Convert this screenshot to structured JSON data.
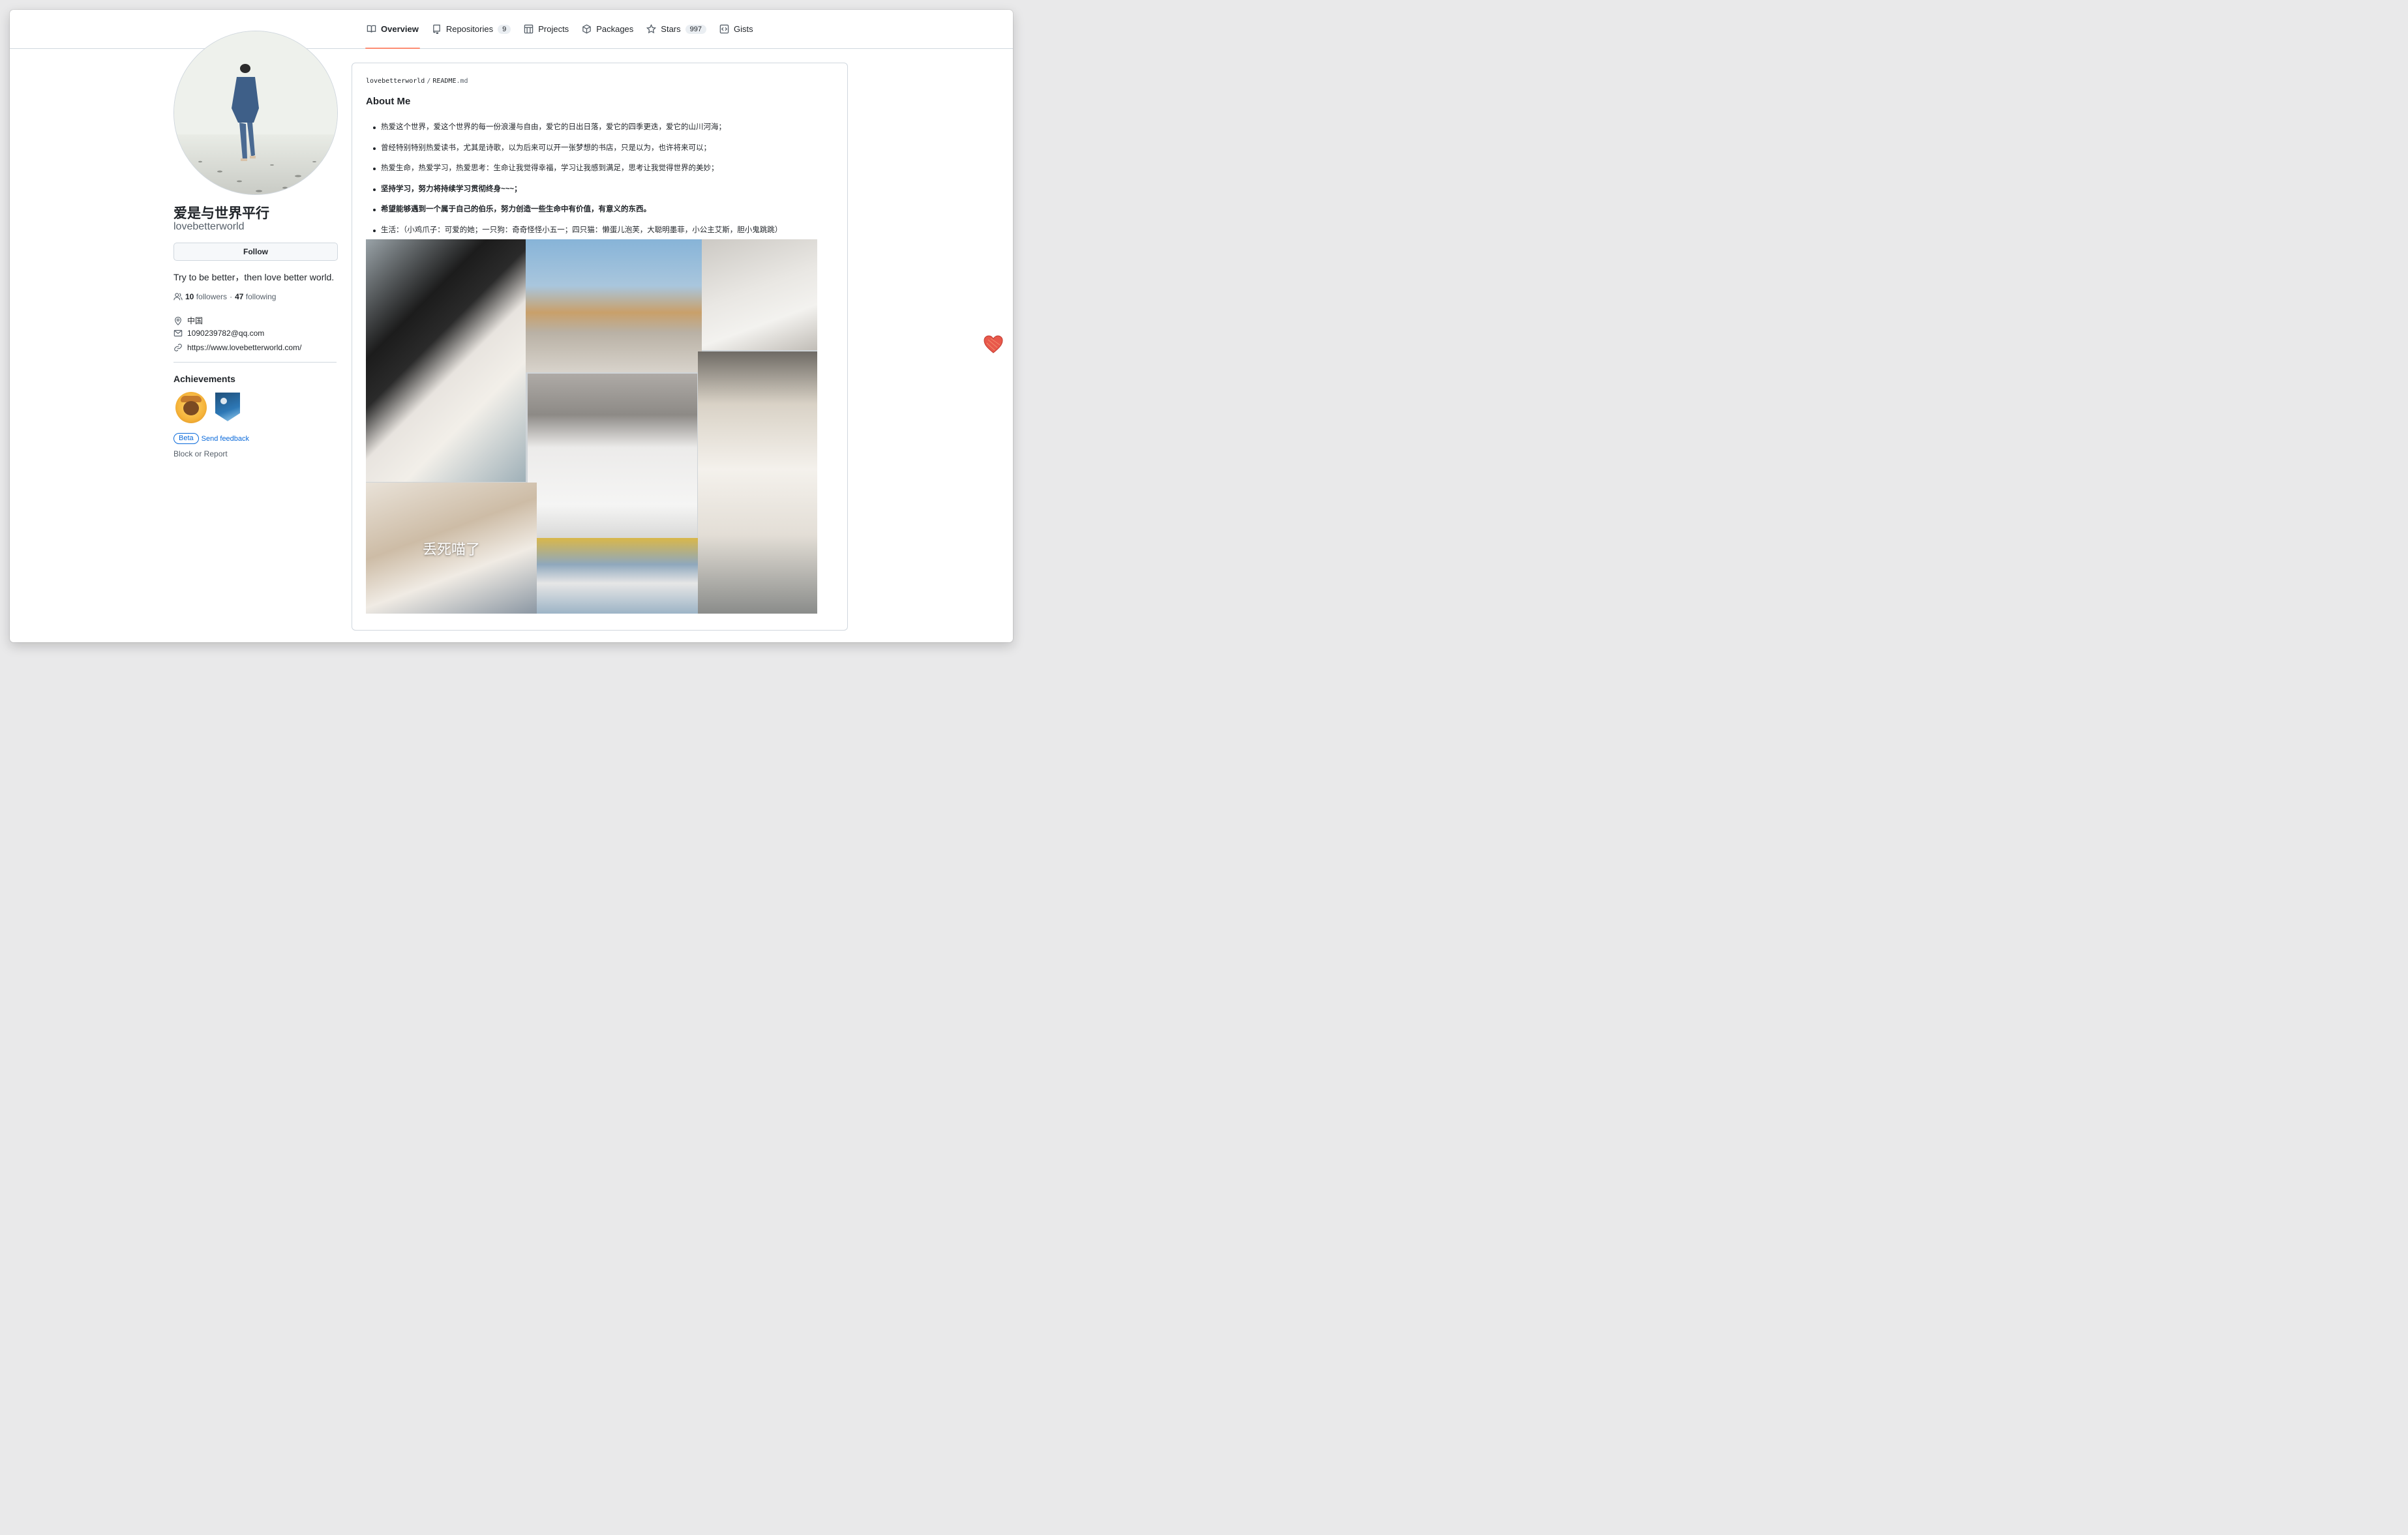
{
  "nav": {
    "tabs": [
      {
        "label": "Overview",
        "icon": "book-icon",
        "active": true
      },
      {
        "label": "Repositories",
        "icon": "repo-icon",
        "count": "9"
      },
      {
        "label": "Projects",
        "icon": "project-icon"
      },
      {
        "label": "Packages",
        "icon": "package-icon"
      },
      {
        "label": "Stars",
        "icon": "star-icon",
        "count": "997"
      },
      {
        "label": "Gists",
        "icon": "code-square-icon"
      }
    ]
  },
  "profile": {
    "display_name": "爱是与世界平行",
    "login": "lovebetterworld",
    "follow_label": "Follow",
    "bio": "Try to be better，then love better world.",
    "followers_count": "10",
    "followers_label": "followers",
    "separator": "·",
    "following_count": "47",
    "following_label": "following",
    "location": "中国",
    "email": "1090239782@qq.com",
    "website": "https://www.lovebetterworld.com/"
  },
  "achievements": {
    "title": "Achievements",
    "badges": [
      "quickdraw-achievement",
      "arctic-code-vault-achievement"
    ],
    "beta_label": "Beta",
    "feedback_label": "Send feedback"
  },
  "block_report": "Block or Report",
  "readme": {
    "owner": "lovebetterworld",
    "separator": "/",
    "file_name": "README",
    "file_ext": ".md",
    "heading": "About Me",
    "bullets": [
      {
        "text": "热爱这个世界，爱这个世界的每一份浪漫与自由，爱它的日出日落，爱它的四季更迭，爱它的山川河海；",
        "bold": false
      },
      {
        "text": "曾经特别特别热爱读书，尤其是诗歌，以为后来可以开一张梦想的书店，只是以为，也许将来可以；",
        "bold": false
      },
      {
        "text": "热爱生命，热爱学习，热爱思考：生命让我觉得幸福，学习让我感到满足，思考让我觉得世界的美妙；",
        "bold": false
      },
      {
        "text": "坚持学习，努力将持续学习贯彻终身~~~；",
        "bold": true
      },
      {
        "text": "希望能够遇到一个属于自己的伯乐，努力创造一些生命中有价值，有意义的东西。",
        "bold": true
      },
      {
        "text": "生活：（小鸡爪子：可爱的她；一只狗：奇奇怪怪小五一；四只猫：懒蛋儿泡芙，大聪明墨菲，小公主艾斯，胆小鬼跳跳）",
        "bold": false
      }
    ],
    "collage_caption": "丢死喵了"
  },
  "colors": {
    "accent_underline": "#fd8c73",
    "link": "#0969da",
    "muted": "#57606a",
    "border": "#d0d7de"
  }
}
